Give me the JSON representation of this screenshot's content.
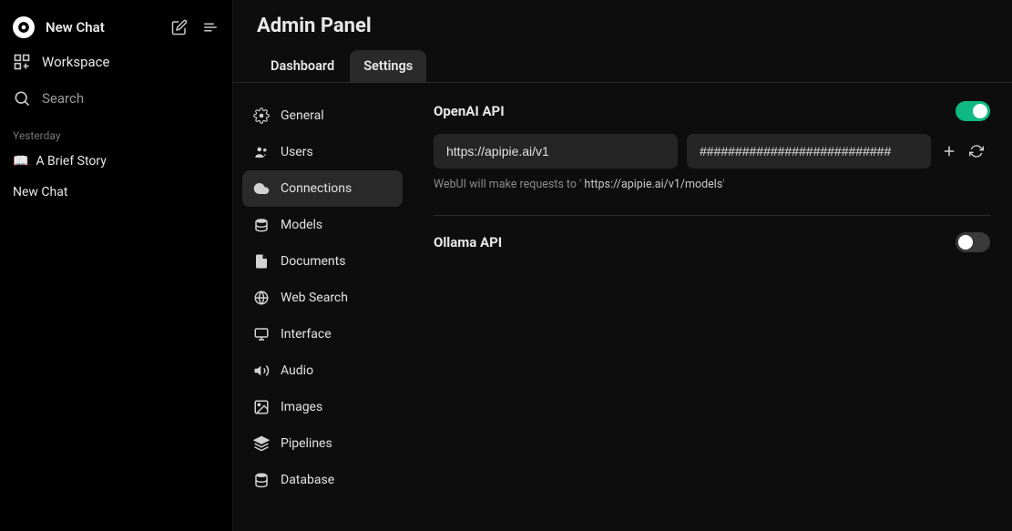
{
  "sidebar": {
    "new_chat": "New Chat",
    "workspace": "Workspace",
    "search": "Search",
    "section_label": "Yesterday",
    "chats": [
      {
        "emoji": "📖",
        "title": "A Brief Story"
      },
      {
        "emoji": "",
        "title": "New Chat"
      }
    ]
  },
  "header": {
    "title": "Admin Panel",
    "tabs": {
      "dashboard": "Dashboard",
      "settings": "Settings"
    }
  },
  "settings_nav": {
    "general": "General",
    "users": "Users",
    "connections": "Connections",
    "models": "Models",
    "documents": "Documents",
    "web_search": "Web Search",
    "interface": "Interface",
    "audio": "Audio",
    "images": "Images",
    "pipelines": "Pipelines",
    "database": "Database"
  },
  "content": {
    "openai": {
      "title": "OpenAI API",
      "url": "https://apipie.ai/v1",
      "key": "###########################",
      "hint_prefix": "WebUI will make requests to '",
      "hint_url": " https://apipie.ai/v1/models",
      "hint_suffix": "'"
    },
    "ollama": {
      "title": "Ollama API"
    }
  }
}
